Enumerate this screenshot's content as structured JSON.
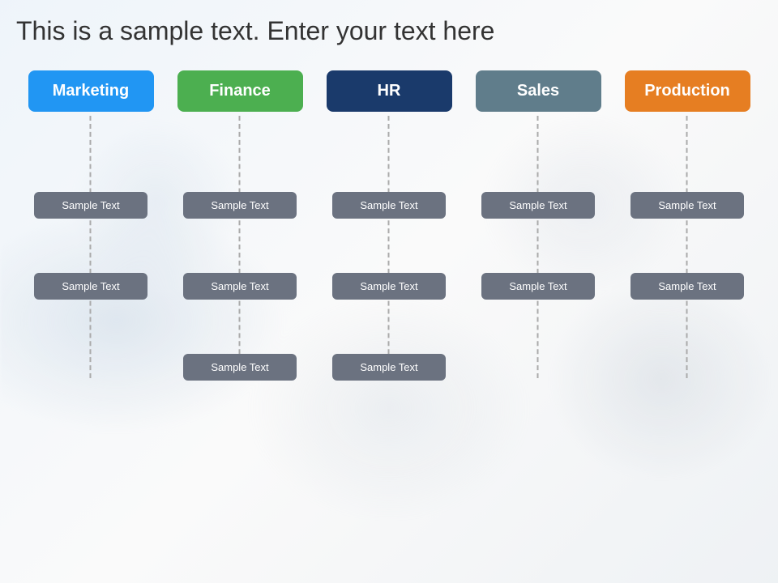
{
  "title": "This is a sample text. Enter your text here",
  "columns": [
    {
      "id": "marketing",
      "label": "Marketing",
      "colorClass": "header-marketing",
      "items": [
        "Sample Text",
        "Sample Text"
      ]
    },
    {
      "id": "finance",
      "label": "Finance",
      "colorClass": "header-finance",
      "items": [
        "Sample Text",
        "Sample Text",
        "Sample Text"
      ]
    },
    {
      "id": "hr",
      "label": "HR",
      "colorClass": "header-hr",
      "items": [
        "Sample Text",
        "Sample Text",
        "Sample Text"
      ]
    },
    {
      "id": "sales",
      "label": "Sales",
      "colorClass": "header-sales",
      "items": [
        "Sample Text",
        "Sample Text"
      ]
    },
    {
      "id": "production",
      "label": "Production",
      "colorClass": "header-production",
      "items": [
        "Sample Text",
        "Sample Text"
      ]
    }
  ],
  "colors": {
    "marketing": "#2196F3",
    "finance": "#4CAF50",
    "hr": "#1A3A6B",
    "sales": "#607D8B",
    "production": "#E67E22",
    "subbox": "#6b7280",
    "line": "#aaaaaa"
  }
}
